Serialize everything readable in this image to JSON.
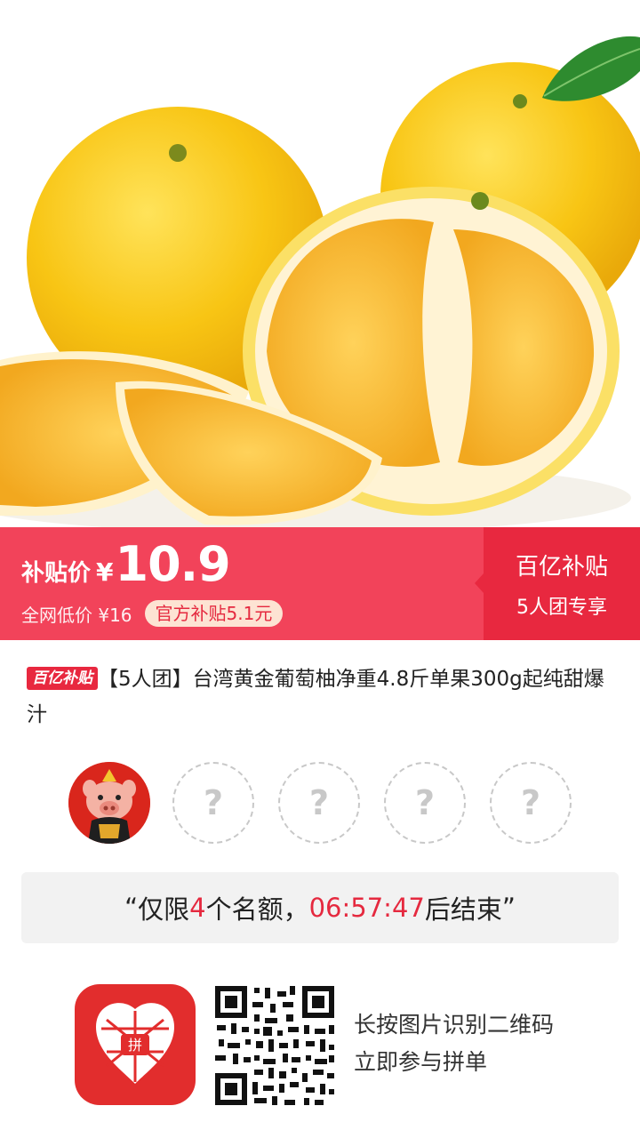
{
  "banner": {
    "price_label": "补贴价",
    "currency": "¥",
    "price": "10.9",
    "original_price": "全网低价 ¥16",
    "subsidy_note": "官方补贴5.1元",
    "side_title": "百亿补贴",
    "side_subtitle": "5人团专享"
  },
  "product": {
    "tag": "百亿补贴",
    "title": "【5人团】台湾黄金葡萄柚净重4.8斤单果300g起纯甜爆汁"
  },
  "group": {
    "empty_slot_symbol": "?"
  },
  "countdown": {
    "open_quote": "“",
    "prefix": "仅限",
    "slots": "4",
    "middle": "个名额，",
    "time": "06:57:47",
    "suffix": "后结束",
    "close_quote": "”"
  },
  "footer": {
    "line1": "长按图片识别二维码",
    "line2": "立即参与拼单"
  },
  "colors": {
    "banner": "#f2435a",
    "banner_side": "#e8283f",
    "accent_red": "#e5293f",
    "pill_bg": "#fde3d3"
  },
  "icons": {
    "app_logo": "pinduoduo-logo-icon",
    "qr": "qr-code-icon",
    "avatar": "pig-avatar-icon"
  }
}
